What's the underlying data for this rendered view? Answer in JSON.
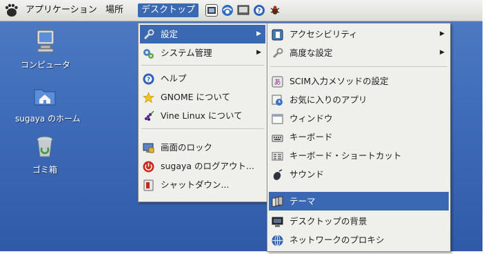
{
  "panel": {
    "applications": "アプリケーション",
    "places": "場所",
    "desktop": "デスクトップ"
  },
  "desktop_icons": {
    "computer": "コンピュータ",
    "home": "sugaya のホーム",
    "trash": "ゴミ箱"
  },
  "desktop_menu": {
    "settings": "設定",
    "system_admin": "システム管理",
    "help": "ヘルプ",
    "about_gnome": "GNOME について",
    "about_vine": "Vine Linux について",
    "lock_screen": "画面のロック",
    "logout": "sugaya のログアウト...",
    "shutdown": "シャットダウン..."
  },
  "settings_menu": {
    "accessibility": "アクセシビリティ",
    "advanced": "高度な設定",
    "scim": "SCIM入力メソッドの設定",
    "favorite_apps": "お気に入りのアプリ",
    "windows": "ウィンドウ",
    "keyboard": "キーボード",
    "keyboard_shortcuts": "キーボード・ショートカット",
    "sound": "サウンド",
    "theme": "テーマ",
    "desktop_background": "デスクトップの背景",
    "network_proxy": "ネットワークのプロキシ"
  },
  "colors": {
    "highlight": "#3b68b3",
    "desktop": "#3f6cb9",
    "menu_bg": "#efefeb"
  }
}
